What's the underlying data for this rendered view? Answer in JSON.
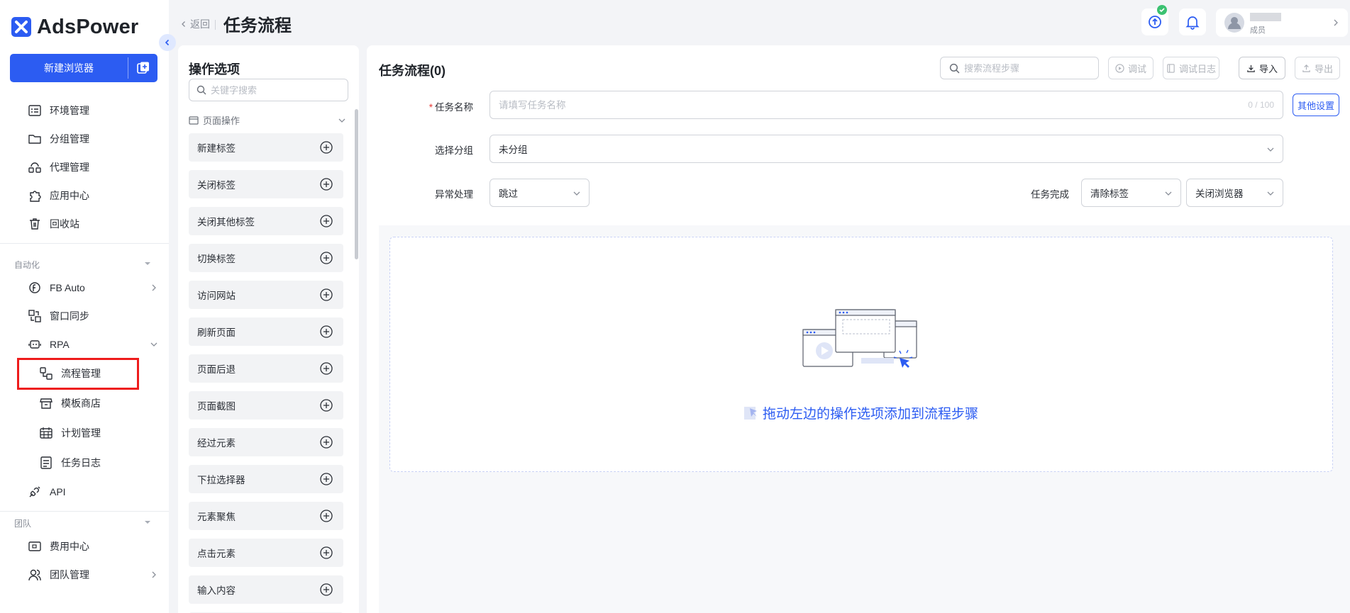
{
  "app": {
    "name": "AdsPower"
  },
  "sidebar": {
    "new_browser": "新建浏览器",
    "items": [
      {
        "label": "环境管理"
      },
      {
        "label": "分组管理"
      },
      {
        "label": "代理管理"
      },
      {
        "label": "应用中心"
      },
      {
        "label": "回收站"
      }
    ],
    "automation_section": "自动化",
    "automation": [
      {
        "label": "FB Auto"
      },
      {
        "label": "窗口同步"
      },
      {
        "label": "RPA"
      }
    ],
    "rpa_sub": [
      {
        "label": "流程管理"
      },
      {
        "label": "模板商店"
      },
      {
        "label": "计划管理"
      },
      {
        "label": "任务日志"
      }
    ],
    "api": "API",
    "team_section": "团队",
    "team": [
      {
        "label": "费用中心"
      },
      {
        "label": "团队管理"
      }
    ]
  },
  "header": {
    "back": "返回",
    "title": "任务流程",
    "user_role": "成员"
  },
  "ops": {
    "title": "操作选项",
    "search_placeholder": "关键字搜索",
    "group": "页面操作",
    "items": [
      {
        "label": "新建标签"
      },
      {
        "label": "关闭标签"
      },
      {
        "label": "关闭其他标签"
      },
      {
        "label": "切换标签"
      },
      {
        "label": "访问网站"
      },
      {
        "label": "刷新页面"
      },
      {
        "label": "页面后退"
      },
      {
        "label": "页面截图"
      },
      {
        "label": "经过元素"
      },
      {
        "label": "下拉选择器"
      },
      {
        "label": "元素聚焦"
      },
      {
        "label": "点击元素"
      },
      {
        "label": "输入内容"
      }
    ]
  },
  "task": {
    "title": "任务流程(0)",
    "search_placeholder": "搜索流程步骤",
    "debug": "调试",
    "debug_log": "调试日志",
    "import": "导入",
    "export": "导出",
    "name_label": "任务名称",
    "name_placeholder": "请填写任务名称",
    "name_counter": "0 / 100",
    "other_settings": "其他设置",
    "group_label": "选择分组",
    "group_value": "未分组",
    "exception_label": "异常处理",
    "exception_value": "跳过",
    "complete_label": "任务完成",
    "complete_value1": "清除标签",
    "complete_value2": "关闭浏览器",
    "empty_hint": "拖动左边的操作选项添加到流程步骤"
  },
  "colors": {
    "accent": "#2c5cf2",
    "highlight": "#ee1c1c"
  }
}
